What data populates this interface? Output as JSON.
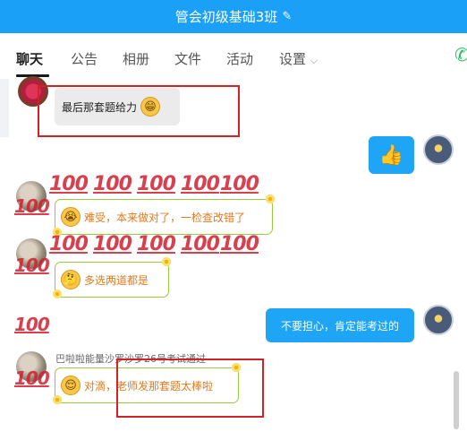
{
  "window": {
    "title": "管会初级基础3班"
  },
  "tabs": [
    {
      "label": "聊天"
    },
    {
      "label": "公告"
    },
    {
      "label": "相册"
    },
    {
      "label": "文件"
    },
    {
      "label": "活动"
    },
    {
      "label": "设置"
    }
  ],
  "messages": {
    "m1": {
      "text": "最后那套题给力",
      "emoji": "grin-icon"
    },
    "m2": {
      "emoji": "thumbs-up-icon"
    },
    "m3": {
      "text": "难受，本来做对了，一检查改错了",
      "emoji": "crying-face-icon"
    },
    "m4": {
      "text": "多选两道都是",
      "emoji": "thinking-face-icon"
    },
    "m5": {
      "text": "不要担心，肯定能考过的"
    },
    "m6": {
      "sender": "巴啦啦能量沙罗沙罗26号考试通过",
      "text": "对滴，老师发那套题太棒啦",
      "emoji": "smile-face-icon"
    }
  },
  "colors": {
    "titlebar": "#1ba0f7",
    "accent_green": "#20c35f",
    "bubble_blue": "#1ea5f5",
    "highlight_red": "#d32226"
  },
  "decor": {
    "hundred_glyph": "100"
  }
}
